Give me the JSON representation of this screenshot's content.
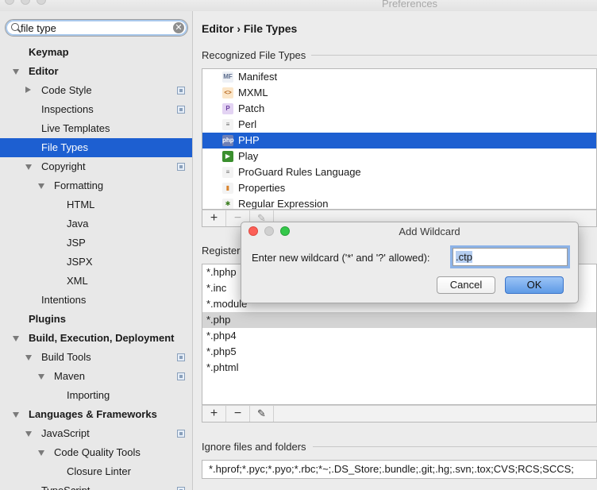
{
  "window": {
    "title": "Preferences"
  },
  "search": {
    "value": "file type"
  },
  "sidebar": {
    "items": [
      {
        "label": "Keymap",
        "indent": 0,
        "arrow": "none",
        "bold": true,
        "selected": false,
        "project_icon": false
      },
      {
        "label": "Editor",
        "indent": 0,
        "arrow": "down",
        "bold": true,
        "selected": false,
        "project_icon": false
      },
      {
        "label": "Code Style",
        "indent": 1,
        "arrow": "right",
        "bold": false,
        "selected": false,
        "project_icon": true
      },
      {
        "label": "Inspections",
        "indent": 1,
        "arrow": "none",
        "bold": false,
        "selected": false,
        "project_icon": true
      },
      {
        "label": "Live Templates",
        "indent": 1,
        "arrow": "none",
        "bold": false,
        "selected": false,
        "project_icon": false
      },
      {
        "label": "File Types",
        "indent": 1,
        "arrow": "none",
        "bold": false,
        "selected": true,
        "project_icon": false
      },
      {
        "label": "Copyright",
        "indent": 1,
        "arrow": "down",
        "bold": false,
        "selected": false,
        "project_icon": true
      },
      {
        "label": "Formatting",
        "indent": 2,
        "arrow": "down",
        "bold": false,
        "selected": false,
        "project_icon": false
      },
      {
        "label": "HTML",
        "indent": 3,
        "arrow": "none",
        "bold": false,
        "selected": false,
        "project_icon": false
      },
      {
        "label": "Java",
        "indent": 3,
        "arrow": "none",
        "bold": false,
        "selected": false,
        "project_icon": false
      },
      {
        "label": "JSP",
        "indent": 3,
        "arrow": "none",
        "bold": false,
        "selected": false,
        "project_icon": false
      },
      {
        "label": "JSPX",
        "indent": 3,
        "arrow": "none",
        "bold": false,
        "selected": false,
        "project_icon": false
      },
      {
        "label": "XML",
        "indent": 3,
        "arrow": "none",
        "bold": false,
        "selected": false,
        "project_icon": false
      },
      {
        "label": "Intentions",
        "indent": 1,
        "arrow": "none",
        "bold": false,
        "selected": false,
        "project_icon": false
      },
      {
        "label": "Plugins",
        "indent": 0,
        "arrow": "none",
        "bold": true,
        "selected": false,
        "project_icon": false
      },
      {
        "label": "Build, Execution, Deployment",
        "indent": 0,
        "arrow": "down",
        "bold": true,
        "selected": false,
        "project_icon": false
      },
      {
        "label": "Build Tools",
        "indent": 1,
        "arrow": "down",
        "bold": false,
        "selected": false,
        "project_icon": true
      },
      {
        "label": "Maven",
        "indent": 2,
        "arrow": "down",
        "bold": false,
        "selected": false,
        "project_icon": true
      },
      {
        "label": "Importing",
        "indent": 3,
        "arrow": "none",
        "bold": false,
        "selected": false,
        "project_icon": false
      },
      {
        "label": "Languages & Frameworks",
        "indent": 0,
        "arrow": "down",
        "bold": true,
        "selected": false,
        "project_icon": false
      },
      {
        "label": "JavaScript",
        "indent": 1,
        "arrow": "down",
        "bold": false,
        "selected": false,
        "project_icon": true
      },
      {
        "label": "Code Quality Tools",
        "indent": 2,
        "arrow": "down",
        "bold": false,
        "selected": false,
        "project_icon": false
      },
      {
        "label": "Closure Linter",
        "indent": 3,
        "arrow": "none",
        "bold": false,
        "selected": false,
        "project_icon": false
      },
      {
        "label": "TypeScript",
        "indent": 1,
        "arrow": "none",
        "bold": false,
        "selected": false,
        "project_icon": true
      }
    ]
  },
  "main": {
    "breadcrumb": "Editor › File Types",
    "recognized_title": "Recognized File Types",
    "registered_title": "Registered Patterns",
    "ignore_title": "Ignore files and folders",
    "ignore_value": "*.hprof;*.pyc;*.pyo;*.rbc;*~;.DS_Store;.bundle;.git;.hg;.svn;.tox;CVS;RCS;SCCS;",
    "file_types": [
      {
        "label": "Manifest",
        "icon": "manifest-icon",
        "glyph": "MF",
        "color": "#5a6b8c",
        "bg": "#eef1f6",
        "selected": false
      },
      {
        "label": "MXML",
        "icon": "mxml-icon",
        "glyph": "<>",
        "color": "#b5651d",
        "bg": "#fbe6c9",
        "selected": false
      },
      {
        "label": "Patch",
        "icon": "patch-icon",
        "glyph": "P",
        "color": "#6b3fa0",
        "bg": "#e3d3f3",
        "selected": false
      },
      {
        "label": "Perl",
        "icon": "perl-icon",
        "glyph": "≡",
        "color": "#6b6b6b",
        "bg": "#f3f3f3",
        "selected": false
      },
      {
        "label": "PHP",
        "icon": "php-icon",
        "glyph": "php",
        "color": "#ffffff",
        "bg": "#6f7fb5",
        "selected": true
      },
      {
        "label": "Play",
        "icon": "play-icon",
        "glyph": "▶",
        "color": "#ffffff",
        "bg": "#3a8f2e",
        "selected": false
      },
      {
        "label": "ProGuard Rules Language",
        "icon": "proguard-icon",
        "glyph": "≡",
        "color": "#6b6b6b",
        "bg": "#f3f3f3",
        "selected": false
      },
      {
        "label": "Properties",
        "icon": "properties-icon",
        "glyph": "▮",
        "color": "#d9822b",
        "bg": "#f3f3f3",
        "selected": false
      },
      {
        "label": "Regular Expression",
        "icon": "regex-icon",
        "glyph": "✱",
        "color": "#3a7d1e",
        "bg": "#f3f3f3",
        "selected": false
      }
    ],
    "patterns": [
      {
        "value": "*.hphp",
        "selected": false
      },
      {
        "value": "*.inc",
        "selected": false
      },
      {
        "value": "*.module",
        "selected": false
      },
      {
        "value": "*.php",
        "selected": true
      },
      {
        "value": "*.php4",
        "selected": false
      },
      {
        "value": "*.php5",
        "selected": false
      },
      {
        "value": "*.phtml",
        "selected": false
      }
    ],
    "toolbar": {
      "add": "+",
      "remove": "−",
      "edit": "✎"
    }
  },
  "dialog": {
    "title": "Add Wildcard",
    "prompt": "Enter new wildcard ('*' and '?' allowed):",
    "value": ".ctp",
    "cancel_label": "Cancel",
    "ok_label": "OK"
  },
  "colors": {
    "selection": "#1d5fd1",
    "close": "#fc5f57",
    "minimize": "#cfcfcf",
    "zoom": "#34c84a"
  }
}
